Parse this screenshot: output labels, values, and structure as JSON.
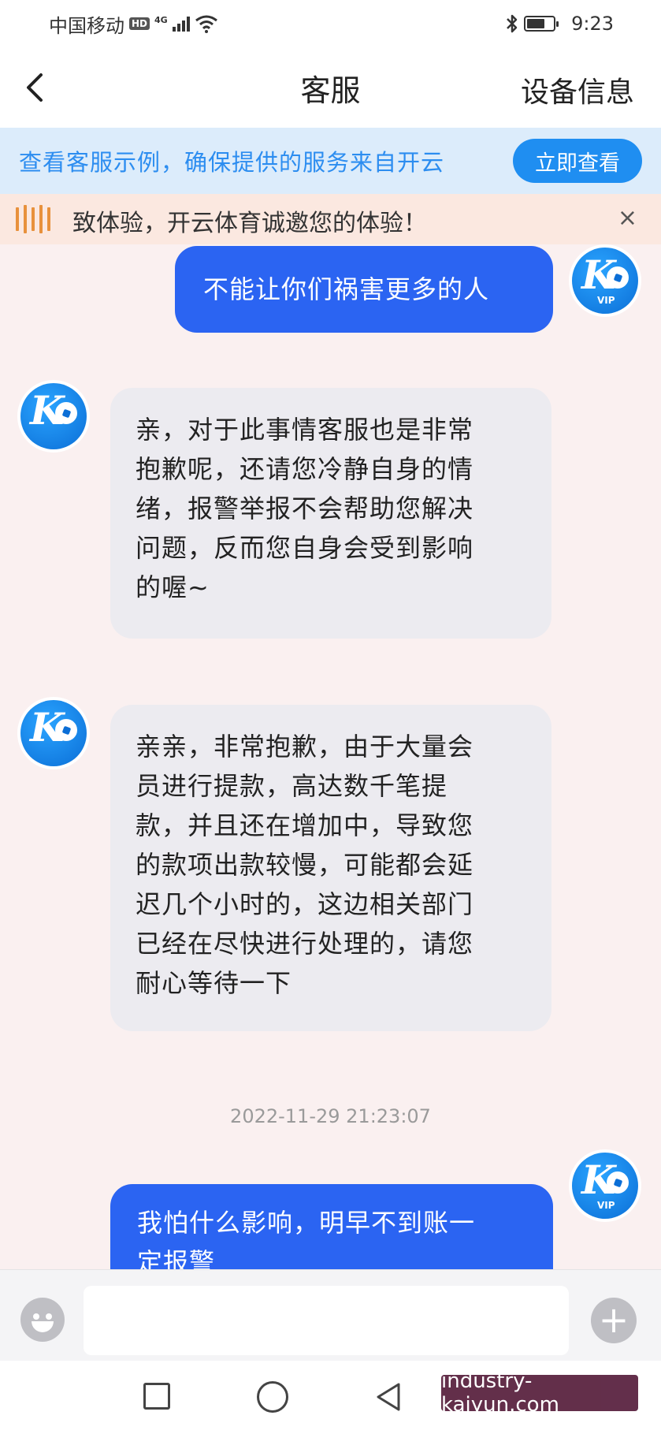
{
  "status_bar": {
    "carrier": "中国移动",
    "hd": "HD",
    "network": "4G",
    "time": "9:23"
  },
  "nav": {
    "title": "客服",
    "right_label": "设备信息",
    "back_icon": "chevron-left-icon"
  },
  "verify_banner": {
    "text": "查看客服示例，确保提供的服务来自开云",
    "button_label": "立即查看"
  },
  "notice": {
    "text": "致体验，开云体育诚邀您的体验！",
    "close_label": "×"
  },
  "messages": [
    {
      "role": "user",
      "text": "不能让你们祸害更多的人"
    },
    {
      "role": "agent",
      "lines": [
        "亲，对于此事情客服也是非常",
        "抱歉呢，还请您冷静自身的情",
        "绪，报警举报不会帮助您解决",
        "问题，反而您自身会受到影响",
        "的喔~"
      ]
    },
    {
      "role": "agent",
      "lines": [
        "亲亲，非常抱歉，由于大量会",
        "员进行提款，高达数千笔提",
        "款，并且还在增加中，导致您",
        "的款项出款较慢，可能都会延",
        "迟几个小时的，这边相关部门",
        "已经在尽快进行处理的，请您",
        "耐心等待一下"
      ]
    },
    {
      "role": "timestamp",
      "text": "2022-11-29 21:23:07"
    },
    {
      "role": "user",
      "lines": [
        "我怕什么影响，明早不到账一",
        "定报警"
      ]
    }
  ],
  "avatar": {
    "letter": "K",
    "vip_label": "VIP"
  },
  "colors": {
    "user_bubble": "#2b64f2",
    "agent_bubble": "#ecebf0",
    "accent": "#1f8ef1",
    "banner_bg": "#dcecfb",
    "notice_bg": "#fbe8e0"
  },
  "input_bar": {
    "emoji_icon": "emoji-icon",
    "plus_icon": "plus-icon",
    "placeholder": ""
  },
  "watermark": {
    "text": "industry-kaiyun.com"
  }
}
